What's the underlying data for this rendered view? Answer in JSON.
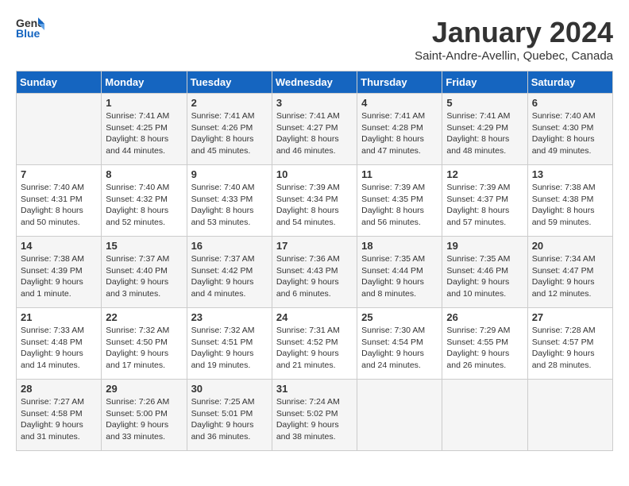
{
  "logo": {
    "general": "General",
    "blue": "Blue"
  },
  "title": "January 2024",
  "subtitle": "Saint-Andre-Avellin, Quebec, Canada",
  "days_of_week": [
    "Sunday",
    "Monday",
    "Tuesday",
    "Wednesday",
    "Thursday",
    "Friday",
    "Saturday"
  ],
  "weeks": [
    [
      {
        "day": "",
        "sunrise": "",
        "sunset": "",
        "daylight": ""
      },
      {
        "day": "1",
        "sunrise": "Sunrise: 7:41 AM",
        "sunset": "Sunset: 4:25 PM",
        "daylight": "Daylight: 8 hours and 44 minutes."
      },
      {
        "day": "2",
        "sunrise": "Sunrise: 7:41 AM",
        "sunset": "Sunset: 4:26 PM",
        "daylight": "Daylight: 8 hours and 45 minutes."
      },
      {
        "day": "3",
        "sunrise": "Sunrise: 7:41 AM",
        "sunset": "Sunset: 4:27 PM",
        "daylight": "Daylight: 8 hours and 46 minutes."
      },
      {
        "day": "4",
        "sunrise": "Sunrise: 7:41 AM",
        "sunset": "Sunset: 4:28 PM",
        "daylight": "Daylight: 8 hours and 47 minutes."
      },
      {
        "day": "5",
        "sunrise": "Sunrise: 7:41 AM",
        "sunset": "Sunset: 4:29 PM",
        "daylight": "Daylight: 8 hours and 48 minutes."
      },
      {
        "day": "6",
        "sunrise": "Sunrise: 7:40 AM",
        "sunset": "Sunset: 4:30 PM",
        "daylight": "Daylight: 8 hours and 49 minutes."
      }
    ],
    [
      {
        "day": "7",
        "sunrise": "Sunrise: 7:40 AM",
        "sunset": "Sunset: 4:31 PM",
        "daylight": "Daylight: 8 hours and 50 minutes."
      },
      {
        "day": "8",
        "sunrise": "Sunrise: 7:40 AM",
        "sunset": "Sunset: 4:32 PM",
        "daylight": "Daylight: 8 hours and 52 minutes."
      },
      {
        "day": "9",
        "sunrise": "Sunrise: 7:40 AM",
        "sunset": "Sunset: 4:33 PM",
        "daylight": "Daylight: 8 hours and 53 minutes."
      },
      {
        "day": "10",
        "sunrise": "Sunrise: 7:39 AM",
        "sunset": "Sunset: 4:34 PM",
        "daylight": "Daylight: 8 hours and 54 minutes."
      },
      {
        "day": "11",
        "sunrise": "Sunrise: 7:39 AM",
        "sunset": "Sunset: 4:35 PM",
        "daylight": "Daylight: 8 hours and 56 minutes."
      },
      {
        "day": "12",
        "sunrise": "Sunrise: 7:39 AM",
        "sunset": "Sunset: 4:37 PM",
        "daylight": "Daylight: 8 hours and 57 minutes."
      },
      {
        "day": "13",
        "sunrise": "Sunrise: 7:38 AM",
        "sunset": "Sunset: 4:38 PM",
        "daylight": "Daylight: 8 hours and 59 minutes."
      }
    ],
    [
      {
        "day": "14",
        "sunrise": "Sunrise: 7:38 AM",
        "sunset": "Sunset: 4:39 PM",
        "daylight": "Daylight: 9 hours and 1 minute."
      },
      {
        "day": "15",
        "sunrise": "Sunrise: 7:37 AM",
        "sunset": "Sunset: 4:40 PM",
        "daylight": "Daylight: 9 hours and 3 minutes."
      },
      {
        "day": "16",
        "sunrise": "Sunrise: 7:37 AM",
        "sunset": "Sunset: 4:42 PM",
        "daylight": "Daylight: 9 hours and 4 minutes."
      },
      {
        "day": "17",
        "sunrise": "Sunrise: 7:36 AM",
        "sunset": "Sunset: 4:43 PM",
        "daylight": "Daylight: 9 hours and 6 minutes."
      },
      {
        "day": "18",
        "sunrise": "Sunrise: 7:35 AM",
        "sunset": "Sunset: 4:44 PM",
        "daylight": "Daylight: 9 hours and 8 minutes."
      },
      {
        "day": "19",
        "sunrise": "Sunrise: 7:35 AM",
        "sunset": "Sunset: 4:46 PM",
        "daylight": "Daylight: 9 hours and 10 minutes."
      },
      {
        "day": "20",
        "sunrise": "Sunrise: 7:34 AM",
        "sunset": "Sunset: 4:47 PM",
        "daylight": "Daylight: 9 hours and 12 minutes."
      }
    ],
    [
      {
        "day": "21",
        "sunrise": "Sunrise: 7:33 AM",
        "sunset": "Sunset: 4:48 PM",
        "daylight": "Daylight: 9 hours and 14 minutes."
      },
      {
        "day": "22",
        "sunrise": "Sunrise: 7:32 AM",
        "sunset": "Sunset: 4:50 PM",
        "daylight": "Daylight: 9 hours and 17 minutes."
      },
      {
        "day": "23",
        "sunrise": "Sunrise: 7:32 AM",
        "sunset": "Sunset: 4:51 PM",
        "daylight": "Daylight: 9 hours and 19 minutes."
      },
      {
        "day": "24",
        "sunrise": "Sunrise: 7:31 AM",
        "sunset": "Sunset: 4:52 PM",
        "daylight": "Daylight: 9 hours and 21 minutes."
      },
      {
        "day": "25",
        "sunrise": "Sunrise: 7:30 AM",
        "sunset": "Sunset: 4:54 PM",
        "daylight": "Daylight: 9 hours and 24 minutes."
      },
      {
        "day": "26",
        "sunrise": "Sunrise: 7:29 AM",
        "sunset": "Sunset: 4:55 PM",
        "daylight": "Daylight: 9 hours and 26 minutes."
      },
      {
        "day": "27",
        "sunrise": "Sunrise: 7:28 AM",
        "sunset": "Sunset: 4:57 PM",
        "daylight": "Daylight: 9 hours and 28 minutes."
      }
    ],
    [
      {
        "day": "28",
        "sunrise": "Sunrise: 7:27 AM",
        "sunset": "Sunset: 4:58 PM",
        "daylight": "Daylight: 9 hours and 31 minutes."
      },
      {
        "day": "29",
        "sunrise": "Sunrise: 7:26 AM",
        "sunset": "Sunset: 5:00 PM",
        "daylight": "Daylight: 9 hours and 33 minutes."
      },
      {
        "day": "30",
        "sunrise": "Sunrise: 7:25 AM",
        "sunset": "Sunset: 5:01 PM",
        "daylight": "Daylight: 9 hours and 36 minutes."
      },
      {
        "day": "31",
        "sunrise": "Sunrise: 7:24 AM",
        "sunset": "Sunset: 5:02 PM",
        "daylight": "Daylight: 9 hours and 38 minutes."
      },
      {
        "day": "",
        "sunrise": "",
        "sunset": "",
        "daylight": ""
      },
      {
        "day": "",
        "sunrise": "",
        "sunset": "",
        "daylight": ""
      },
      {
        "day": "",
        "sunrise": "",
        "sunset": "",
        "daylight": ""
      }
    ]
  ]
}
